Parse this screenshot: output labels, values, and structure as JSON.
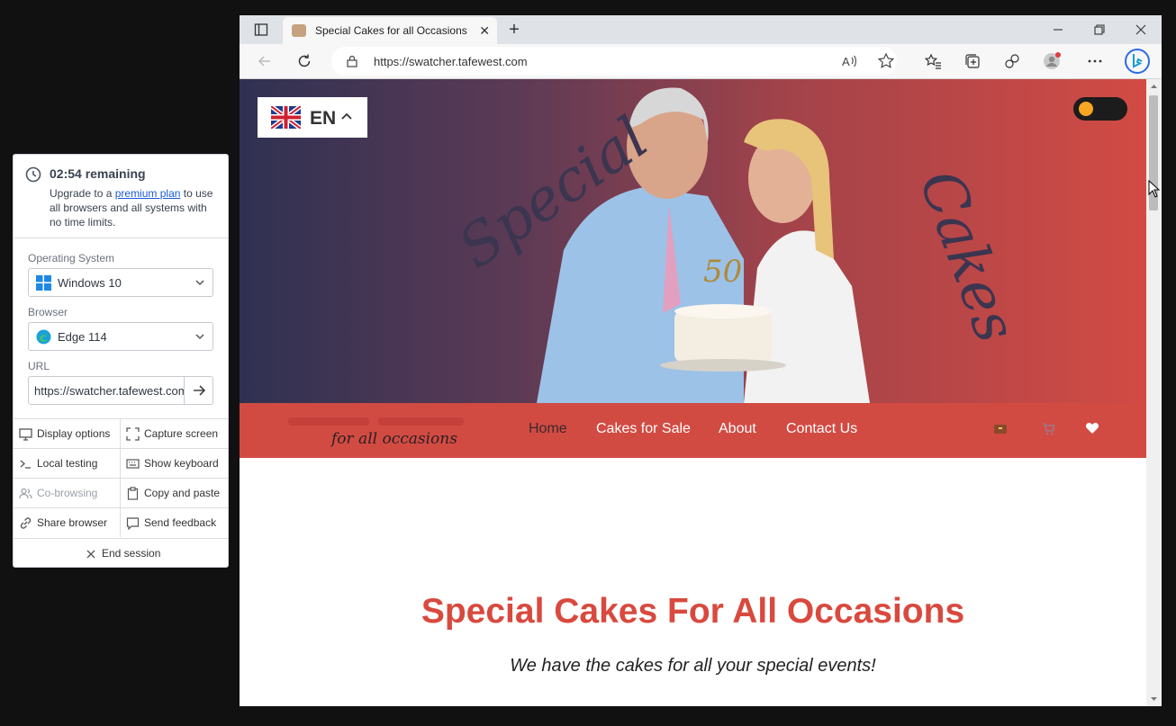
{
  "panel": {
    "timer_title": "02:54 remaining",
    "note_prefix": "Upgrade to a ",
    "note_link": "premium plan",
    "note_suffix": " to use all browsers and all systems with no time limits.",
    "os_label": "Operating System",
    "os_value": "Windows 10",
    "browser_label": "Browser",
    "browser_value": "Edge 114",
    "url_label": "URL",
    "url_value": "https://swatcher.tafewest.com",
    "actions": [
      {
        "label": "Display options",
        "icon": "monitor-icon"
      },
      {
        "label": "Capture screen",
        "icon": "capture-icon"
      },
      {
        "label": "Local testing",
        "icon": "terminal-icon"
      },
      {
        "label": "Show keyboard",
        "icon": "keyboard-icon"
      },
      {
        "label": "Co-browsing",
        "icon": "users-icon"
      },
      {
        "label": "Copy and paste",
        "icon": "clipboard-icon"
      },
      {
        "label": "Share browser",
        "icon": "link-icon"
      },
      {
        "label": "Send feedback",
        "icon": "feedback-icon"
      }
    ],
    "end_label": "End session"
  },
  "browser": {
    "tab_title": "Special Cakes for all Occasions",
    "address": "https://swatcher.tafewest.com"
  },
  "site": {
    "lang_code": "EN",
    "hero_word_left": "Special",
    "hero_word_right": "Cakes",
    "logo_tagline": "for all occasions",
    "nav": [
      "Home",
      "Cakes for Sale",
      "About",
      "Contact Us"
    ],
    "heading": "Special Cakes For All Occasions",
    "subheading": "We have the cakes for all your special events!"
  },
  "colors": {
    "brand_red": "#d24b43",
    "heading_red": "#d9493e",
    "toggle_knob": "#f5a623"
  }
}
